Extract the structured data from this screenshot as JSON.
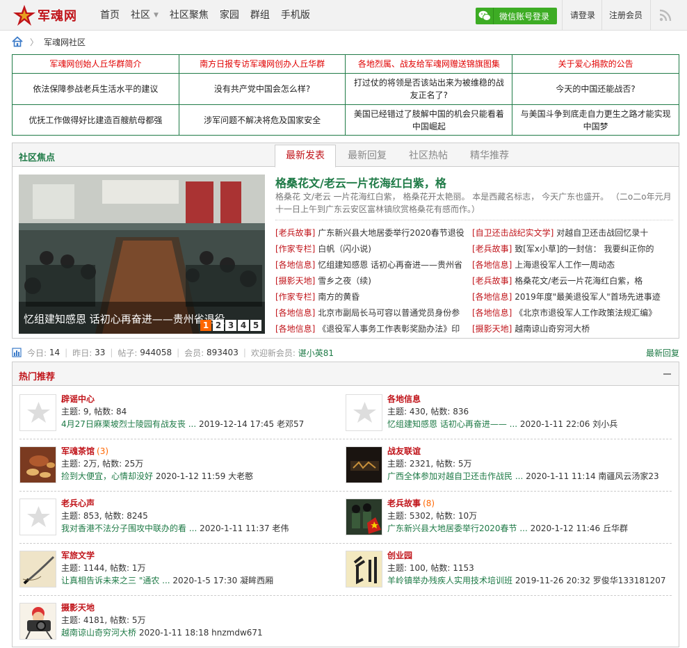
{
  "header": {
    "logo_text": "军魂网",
    "nav": [
      "首页",
      "社区",
      "社区聚焦",
      "家园",
      "群组",
      "手机版"
    ],
    "wechat_login": "微信账号登录",
    "login": "请登录",
    "register": "注册会员"
  },
  "breadcrumb": {
    "current": "军魂网社区"
  },
  "top_links": [
    [
      "军魂网创始人丘华群简介",
      "南方日报专访军魂网创办人丘华群",
      "各地烈属、战友给军魂网赠送锦旗图集",
      "关于爱心捐款的公告"
    ],
    [
      "依法保障参战老兵生活水平的建议",
      "没有共产党中国会怎么样?",
      "打过仗的将领是否该站出来为被维稳的战友正名了?",
      "今天的中国还能战否?"
    ],
    [
      "优抚工作做得好比建造百艘航母都强",
      "涉军问题不解决将危及国家安全",
      "美国已经错过了肢解中国的机会只能看着中国崛起",
      "与美国斗争到底走自力更生之路才能实现中国梦"
    ]
  ],
  "focus": {
    "title": "社区焦点",
    "tabs": [
      "最新发表",
      "最新回复",
      "社区热帖",
      "精华推荐"
    ],
    "active_tab": 0,
    "slide_caption": "忆组建知感恩 话初心再奋进——贵州省退役",
    "pages": [
      "1",
      "2",
      "3",
      "4",
      "5"
    ],
    "headline": "格桑花文/老云一片花海红白紫，格",
    "summary": "格桑花 文/老云 一片花海红白紫， 格桑花开太艳丽。 本是西藏名标志， 今天广东也盛开。 （二o二o年元月十一日上午到广东云安区富林镇欣赏格桑花有感而作。）",
    "left_news": [
      {
        "cat": "[老兵故事]",
        "title": "广东新兴县大地居委举行2020春节退役"
      },
      {
        "cat": "[作家专栏]",
        "title": "白帆（闪小说)"
      },
      {
        "cat": "[各地信息]",
        "title": "忆组建知感恩 话初心再奋进——贵州省"
      },
      {
        "cat": "[摄影天地]",
        "title": "雪乡之夜（续)"
      },
      {
        "cat": "[作家专栏]",
        "title": "南方的黄昏"
      },
      {
        "cat": "[各地信息]",
        "title": "北京市副局长马可容以普通党员身份参"
      },
      {
        "cat": "[各地信息]",
        "title": "《退役军人事务工作表彰奖励办法》印"
      }
    ],
    "right_news": [
      {
        "cat": "[自卫还击战纪实文学]",
        "title": "对越自卫还击战回忆录十"
      },
      {
        "cat": "[老兵故事]",
        "title": "致[军x小草]的一封信： 我要纠正你的"
      },
      {
        "cat": "[各地信息]",
        "title": "上海退役军人工作一周动态"
      },
      {
        "cat": "[老兵故事]",
        "title": "格桑花文/老云一片花海红白紫，格"
      },
      {
        "cat": "[各地信息]",
        "title": "2019年度\"最美退役军人\"首场先进事迹"
      },
      {
        "cat": "[各地信息]",
        "title": "《北京市退役军人工作政策法规汇编》"
      },
      {
        "cat": "[摄影天地]",
        "title": "越南谅山奇穷河大桥"
      }
    ]
  },
  "stats": {
    "today_label": "今日:",
    "today": "14",
    "yesterday_label": "昨日:",
    "yesterday": "33",
    "posts_label": "帖子:",
    "posts": "944058",
    "members_label": "会员:",
    "members": "893403",
    "welcome_label": "欢迎新会员:",
    "newest": "谌小英81",
    "latest_replies": "最新回复"
  },
  "hot": {
    "title": "热门推荐",
    "forums": [
      {
        "name": "辟谣中心",
        "new": "",
        "stat": "主题: 9, 帖数: 84",
        "last_title": "4月27日麻栗坡烈士陵园有战友丧 ...",
        "last_meta": "2019-12-14 17:45 老邓57",
        "icon": "star-icon"
      },
      {
        "name": "各地信息",
        "new": "",
        "stat": "主题: 430, 帖数: 836",
        "last_title": "忆组建知感恩 话初心再奋进—— ...",
        "last_meta": "2020-1-11 22:06 刘小兵",
        "icon": "star-icon"
      },
      {
        "name": "军魂茶馆",
        "new": "(3)",
        "stat": "主题: 2万, 帖数: 25万",
        "last_title": "捡到大便宜，心情却没好",
        "last_meta": "2020-1-12 11:59 大老憨",
        "icon": "tea-icon"
      },
      {
        "name": "战友联谊",
        "new": "",
        "stat": "主题: 2321, 帖数: 5万",
        "last_title": "广西全体参加对越自卫还击作战民 ...",
        "last_meta": "2020-1-11 11:14 南疆风云汤家23",
        "icon": "comrade-icon"
      },
      {
        "name": "老兵心声",
        "new": "",
        "stat": "主题: 853, 帖数: 8245",
        "last_title": "我对香港不法分子围攻中联办的看 ...",
        "last_meta": "2020-1-11 11:37 老伟",
        "icon": "star-icon"
      },
      {
        "name": "老兵故事",
        "new": "(8)",
        "stat": "主题: 5302, 帖数: 10万",
        "last_title": "广东新兴县大地居委举行2020春节 ...",
        "last_meta": "2020-1-12 11:46 丘华群",
        "icon": "veteran-icon"
      },
      {
        "name": "军旅文学",
        "new": "",
        "stat": "主题: 1144, 帖数: 1万",
        "last_title": "让真相告诉未来之三 \"通农 ...",
        "last_meta": "2020-1-5 17:30 凝眸西厢",
        "icon": "pen-icon"
      },
      {
        "name": "创业园",
        "new": "",
        "stat": "主题: 100, 帖数: 1153",
        "last_title": "羊岭镇举办残疾人实用技术培训班",
        "last_meta": "2019-11-26 20:32 罗俊华133181207",
        "icon": "chuang-icon"
      },
      {
        "name": "摄影天地",
        "new": "",
        "stat": "主题: 4181, 帖数: 5万",
        "last_title": "越南谅山奇穷河大桥",
        "last_meta": "2020-1-11 18:18 hnzmdw671",
        "icon": "camera-icon"
      }
    ]
  }
}
